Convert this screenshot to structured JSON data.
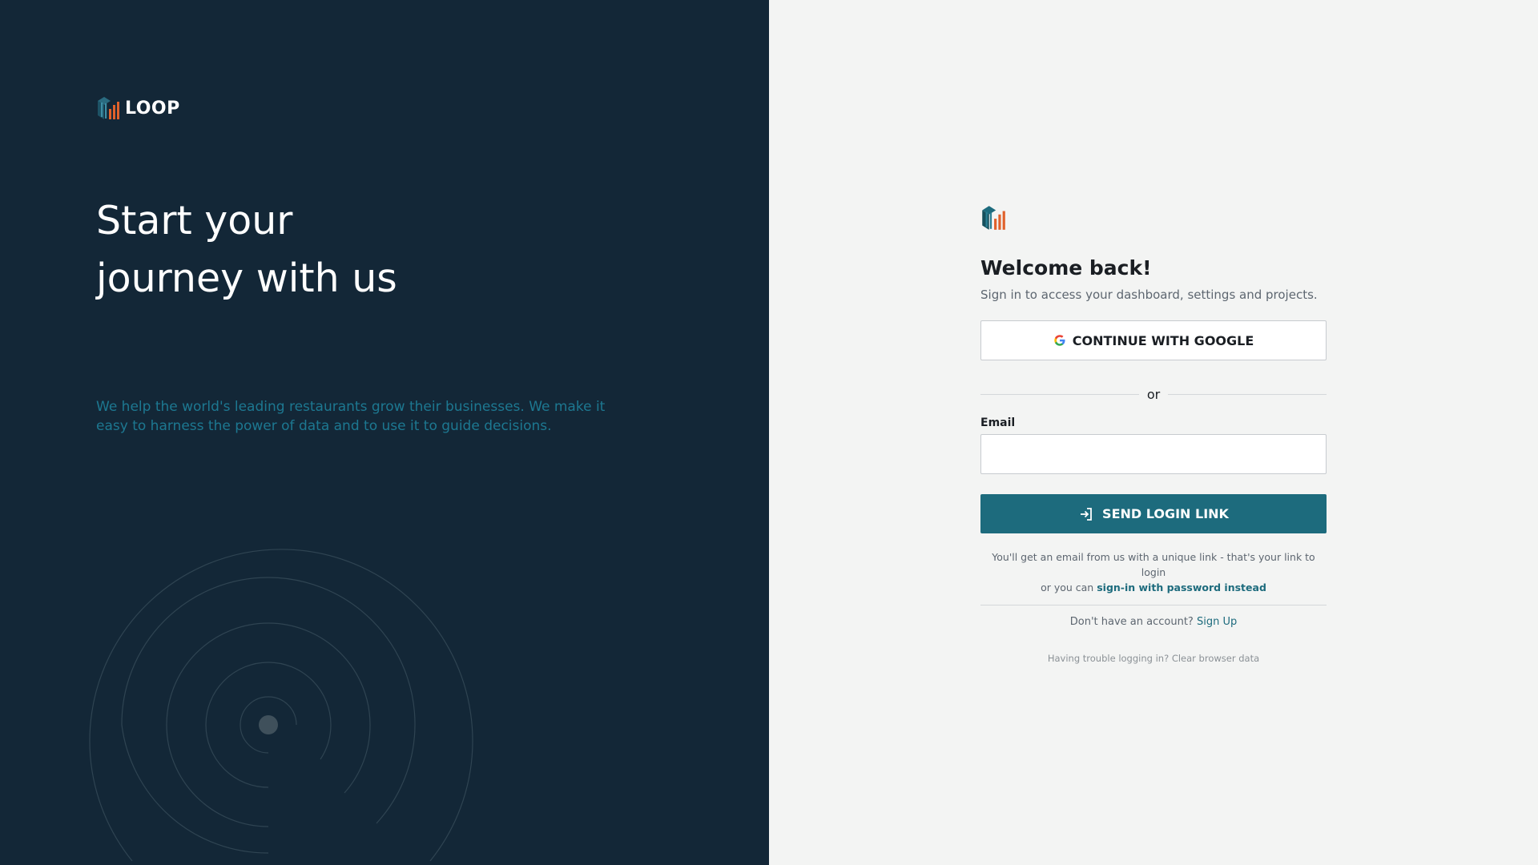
{
  "colors": {
    "left_bg": "#132737",
    "right_bg": "#f3f4f3",
    "accent": "#1d6b7d",
    "blurb": "#1d7891",
    "logo_orange": "#e0612b"
  },
  "left": {
    "brand_name": "LOOP",
    "hero_line1": "Start your",
    "hero_line2": "journey with us",
    "blurb": "We help the world's leading restaurants grow their businesses. We make it easy to harness the power of data and to use it to guide decisions."
  },
  "login": {
    "logo_icon": "loop-logo-icon",
    "title": "Welcome back!",
    "subtitle": "Sign in to access your dashboard, settings and projects.",
    "google_label": "CONTINUE WITH GOOGLE",
    "google_icon": "google-g-icon",
    "divider_text": "or",
    "email_label": "Email",
    "email_value": "",
    "send_label": "SEND LOGIN LINK",
    "send_icon": "login-arrow-icon",
    "hint_line1": "You'll get an email from us with a unique link - that's your link to login",
    "hint_prefix": "or you can ",
    "hint_link": "sign-in with password instead",
    "signup_prefix": "Don't have an account? ",
    "signup_link": "Sign Up",
    "trouble": "Having trouble logging in? Clear browser data"
  }
}
